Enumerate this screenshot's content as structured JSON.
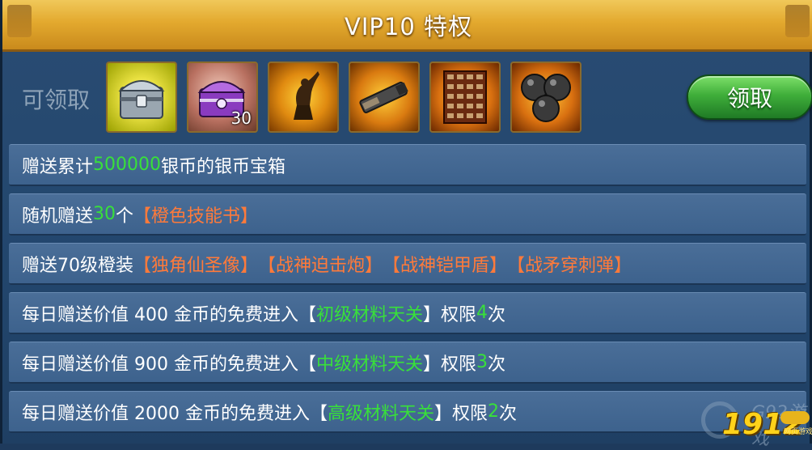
{
  "title": "VIP10 特权",
  "claim": {
    "label": "可领取",
    "button_label": "领取",
    "items": [
      {
        "name": "silver-treasure-chest-icon",
        "quantity": ""
      },
      {
        "name": "purple-treasure-chest-icon",
        "quantity": "30"
      },
      {
        "name": "unicorn-statue-icon",
        "quantity": ""
      },
      {
        "name": "war-god-mortar-icon",
        "quantity": ""
      },
      {
        "name": "war-god-armor-shield-icon",
        "quantity": ""
      },
      {
        "name": "piercing-cannonball-icon",
        "quantity": ""
      }
    ]
  },
  "perks": [
    {
      "parts": [
        {
          "t": "赠送累计 ",
          "c": "w"
        },
        {
          "t": "500000",
          "c": "g"
        },
        {
          "t": " 银币的银币宝箱",
          "c": "w"
        }
      ]
    },
    {
      "parts": [
        {
          "t": "随机赠送 ",
          "c": "w"
        },
        {
          "t": "30",
          "c": "g"
        },
        {
          "t": " 个 ",
          "c": "w"
        },
        {
          "t": "【橙色技能书】",
          "c": "o"
        }
      ]
    },
    {
      "parts": [
        {
          "t": "赠送70级橙装",
          "c": "w"
        },
        {
          "t": "【独角仙圣像】",
          "c": "o"
        },
        {
          "t": "【战神迫击炮】",
          "c": "o"
        },
        {
          "t": "【战神铠甲盾】",
          "c": "o"
        },
        {
          "t": "【战矛穿刺弹】",
          "c": "o"
        }
      ]
    },
    {
      "parts": [
        {
          "t": "每日赠送价值 400 金币的免费进入",
          "c": "w"
        },
        {
          "t": "【",
          "c": "w"
        },
        {
          "t": "初级材料天关",
          "c": "g"
        },
        {
          "t": "】",
          "c": "w"
        },
        {
          "t": "权限 ",
          "c": "w"
        },
        {
          "t": "4",
          "c": "g"
        },
        {
          "t": " 次",
          "c": "w"
        }
      ]
    },
    {
      "parts": [
        {
          "t": "每日赠送价值 900 金币的免费进入",
          "c": "w"
        },
        {
          "t": "【",
          "c": "w"
        },
        {
          "t": "中级材料天关",
          "c": "g"
        },
        {
          "t": "】",
          "c": "w"
        },
        {
          "t": "权限 ",
          "c": "w"
        },
        {
          "t": "3",
          "c": "g"
        },
        {
          "t": " 次",
          "c": "w"
        }
      ]
    },
    {
      "parts": [
        {
          "t": "每日赠送价值 2000 金币的免费进入",
          "c": "w"
        },
        {
          "t": "【",
          "c": "w"
        },
        {
          "t": "高级材料天关",
          "c": "g"
        },
        {
          "t": "】",
          "c": "w"
        },
        {
          "t": "权限 ",
          "c": "w"
        },
        {
          "t": "2",
          "c": "g"
        },
        {
          "t": " 次",
          "c": "w"
        }
      ]
    }
  ],
  "watermark": {
    "text": "G92游戏",
    "number": "1912",
    "sub": "网页游戏"
  },
  "colors": {
    "highlight_green": "#38e03a",
    "highlight_orange": "#ff7a3a",
    "title_gold": "#e3a92e",
    "button_green": "#3fae3a"
  }
}
